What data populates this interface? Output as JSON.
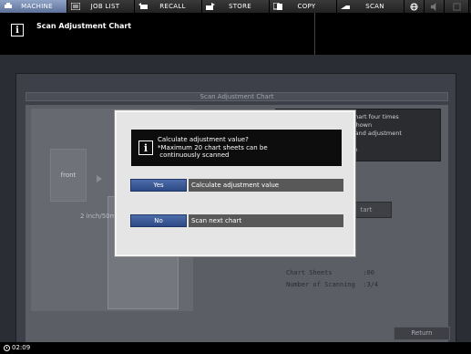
{
  "tabs": [
    {
      "label": "MACHINE",
      "icon": "printer-icon",
      "active": true
    },
    {
      "label": "JOB LIST",
      "icon": "list-icon",
      "active": false
    },
    {
      "label": "RECALL",
      "icon": "recall-icon",
      "active": false
    },
    {
      "label": "STORE",
      "icon": "store-icon",
      "active": false
    },
    {
      "label": "COPY",
      "icon": "copy-icon",
      "active": false
    },
    {
      "label": "SCAN",
      "icon": "scan-icon",
      "active": false
    }
  ],
  "tab_icons": [
    "globe-icon",
    "volume-icon",
    "power-icon"
  ],
  "header": {
    "title": "Scan Adjustment Chart",
    "icon": "info-icon"
  },
  "screen": {
    "title": "Scan Adjustment Chart",
    "front_label": "front",
    "size_label": "2 inch/50mm",
    "description": "t chart four times\nn shown\net and adjustment\ng\ncan",
    "start_label": "tart",
    "chart_sheets_line": "Chart Sheets        :00",
    "scanning_line": "Number of Scanning  :3/4"
  },
  "dialog": {
    "message": "Calculate adjustment value?\n*Maximum 20 chart sheets can be\n continuously scanned",
    "yes_label": "Yes",
    "yes_desc": "Calculate adjustment value",
    "no_label": "No",
    "no_desc": "Scan next chart"
  },
  "return_label": "Return",
  "footer": {
    "time": "02:09"
  },
  "colors": {
    "active_tab": "#7389b5",
    "dialog_button": "#3a5898",
    "dialog_bg": "#e5e5e5"
  }
}
